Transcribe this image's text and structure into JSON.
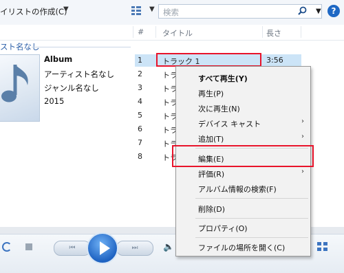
{
  "toolbar": {
    "create_playlist": "イリストの作成(C)",
    "playlist_arrow": "▼",
    "view_arrow": "▼",
    "search_placeholder": "検索",
    "search_arrow": "▼",
    "help": "?"
  },
  "columns": {
    "number": "#",
    "title": "タイトル",
    "length": "長さ"
  },
  "album": {
    "group_label": "スト名なし",
    "name": "Album",
    "artist": "アーティスト名なし",
    "genre": "ジャンル名なし",
    "year": "2015"
  },
  "tracks": [
    {
      "num": "1",
      "title": "トラック 1",
      "length": "3:56"
    },
    {
      "num": "2",
      "title": "トラ",
      "length": ""
    },
    {
      "num": "3",
      "title": "トラ",
      "length": ""
    },
    {
      "num": "4",
      "title": "トラ",
      "length": ""
    },
    {
      "num": "5",
      "title": "トラ",
      "length": ""
    },
    {
      "num": "6",
      "title": "トラ",
      "length": ""
    },
    {
      "num": "7",
      "title": "トラ",
      "length": ""
    },
    {
      "num": "8",
      "title": "トラ",
      "length": ""
    }
  ],
  "context_menu": {
    "play_all": "すべて再生(Y)",
    "play": "再生(P)",
    "play_next": "次に再生(N)",
    "cast_to_device": "デバイス キャスト",
    "add_to": "追加(T)",
    "edit": "編集(E)",
    "rate": "評価(R)",
    "find_album_info": "アルバム情報の検索(F)",
    "delete": "削除(D)",
    "properties": "プロパティ(O)",
    "open_file_location": "ファイルの場所を開く(C)",
    "submenu_arrow": "›"
  },
  "player": {
    "prev": "⏮",
    "next": "⏭",
    "volume": "🔈"
  },
  "colors": {
    "highlight_red": "#e8132a",
    "selection_blue": "#cce4f7",
    "accent_blue": "#1f63c2"
  }
}
